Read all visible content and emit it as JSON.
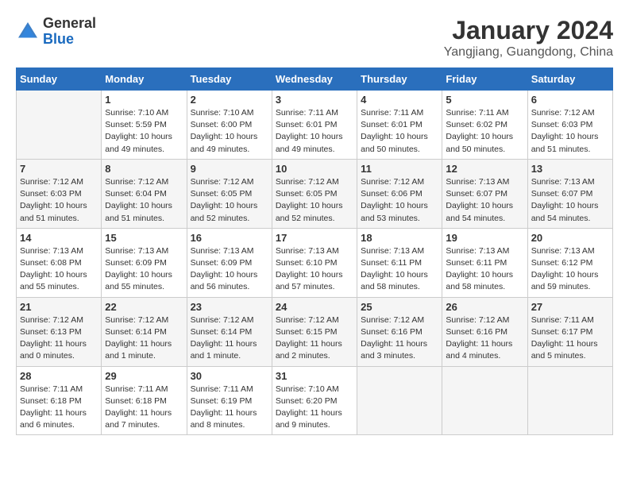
{
  "header": {
    "logo_general": "General",
    "logo_blue": "Blue",
    "month": "January 2024",
    "location": "Yangjiang, Guangdong, China"
  },
  "days_of_week": [
    "Sunday",
    "Monday",
    "Tuesday",
    "Wednesday",
    "Thursday",
    "Friday",
    "Saturday"
  ],
  "weeks": [
    [
      {
        "day": "",
        "sunrise": "",
        "sunset": "",
        "daylight": ""
      },
      {
        "day": "1",
        "sunrise": "Sunrise: 7:10 AM",
        "sunset": "Sunset: 5:59 PM",
        "daylight": "Daylight: 10 hours and 49 minutes."
      },
      {
        "day": "2",
        "sunrise": "Sunrise: 7:10 AM",
        "sunset": "Sunset: 6:00 PM",
        "daylight": "Daylight: 10 hours and 49 minutes."
      },
      {
        "day": "3",
        "sunrise": "Sunrise: 7:11 AM",
        "sunset": "Sunset: 6:01 PM",
        "daylight": "Daylight: 10 hours and 49 minutes."
      },
      {
        "day": "4",
        "sunrise": "Sunrise: 7:11 AM",
        "sunset": "Sunset: 6:01 PM",
        "daylight": "Daylight: 10 hours and 50 minutes."
      },
      {
        "day": "5",
        "sunrise": "Sunrise: 7:11 AM",
        "sunset": "Sunset: 6:02 PM",
        "daylight": "Daylight: 10 hours and 50 minutes."
      },
      {
        "day": "6",
        "sunrise": "Sunrise: 7:12 AM",
        "sunset": "Sunset: 6:03 PM",
        "daylight": "Daylight: 10 hours and 51 minutes."
      }
    ],
    [
      {
        "day": "7",
        "sunrise": "Sunrise: 7:12 AM",
        "sunset": "Sunset: 6:03 PM",
        "daylight": "Daylight: 10 hours and 51 minutes."
      },
      {
        "day": "8",
        "sunrise": "Sunrise: 7:12 AM",
        "sunset": "Sunset: 6:04 PM",
        "daylight": "Daylight: 10 hours and 51 minutes."
      },
      {
        "day": "9",
        "sunrise": "Sunrise: 7:12 AM",
        "sunset": "Sunset: 6:05 PM",
        "daylight": "Daylight: 10 hours and 52 minutes."
      },
      {
        "day": "10",
        "sunrise": "Sunrise: 7:12 AM",
        "sunset": "Sunset: 6:05 PM",
        "daylight": "Daylight: 10 hours and 52 minutes."
      },
      {
        "day": "11",
        "sunrise": "Sunrise: 7:12 AM",
        "sunset": "Sunset: 6:06 PM",
        "daylight": "Daylight: 10 hours and 53 minutes."
      },
      {
        "day": "12",
        "sunrise": "Sunrise: 7:13 AM",
        "sunset": "Sunset: 6:07 PM",
        "daylight": "Daylight: 10 hours and 54 minutes."
      },
      {
        "day": "13",
        "sunrise": "Sunrise: 7:13 AM",
        "sunset": "Sunset: 6:07 PM",
        "daylight": "Daylight: 10 hours and 54 minutes."
      }
    ],
    [
      {
        "day": "14",
        "sunrise": "Sunrise: 7:13 AM",
        "sunset": "Sunset: 6:08 PM",
        "daylight": "Daylight: 10 hours and 55 minutes."
      },
      {
        "day": "15",
        "sunrise": "Sunrise: 7:13 AM",
        "sunset": "Sunset: 6:09 PM",
        "daylight": "Daylight: 10 hours and 55 minutes."
      },
      {
        "day": "16",
        "sunrise": "Sunrise: 7:13 AM",
        "sunset": "Sunset: 6:09 PM",
        "daylight": "Daylight: 10 hours and 56 minutes."
      },
      {
        "day": "17",
        "sunrise": "Sunrise: 7:13 AM",
        "sunset": "Sunset: 6:10 PM",
        "daylight": "Daylight: 10 hours and 57 minutes."
      },
      {
        "day": "18",
        "sunrise": "Sunrise: 7:13 AM",
        "sunset": "Sunset: 6:11 PM",
        "daylight": "Daylight: 10 hours and 58 minutes."
      },
      {
        "day": "19",
        "sunrise": "Sunrise: 7:13 AM",
        "sunset": "Sunset: 6:11 PM",
        "daylight": "Daylight: 10 hours and 58 minutes."
      },
      {
        "day": "20",
        "sunrise": "Sunrise: 7:13 AM",
        "sunset": "Sunset: 6:12 PM",
        "daylight": "Daylight: 10 hours and 59 minutes."
      }
    ],
    [
      {
        "day": "21",
        "sunrise": "Sunrise: 7:12 AM",
        "sunset": "Sunset: 6:13 PM",
        "daylight": "Daylight: 11 hours and 0 minutes."
      },
      {
        "day": "22",
        "sunrise": "Sunrise: 7:12 AM",
        "sunset": "Sunset: 6:14 PM",
        "daylight": "Daylight: 11 hours and 1 minute."
      },
      {
        "day": "23",
        "sunrise": "Sunrise: 7:12 AM",
        "sunset": "Sunset: 6:14 PM",
        "daylight": "Daylight: 11 hours and 1 minute."
      },
      {
        "day": "24",
        "sunrise": "Sunrise: 7:12 AM",
        "sunset": "Sunset: 6:15 PM",
        "daylight": "Daylight: 11 hours and 2 minutes."
      },
      {
        "day": "25",
        "sunrise": "Sunrise: 7:12 AM",
        "sunset": "Sunset: 6:16 PM",
        "daylight": "Daylight: 11 hours and 3 minutes."
      },
      {
        "day": "26",
        "sunrise": "Sunrise: 7:12 AM",
        "sunset": "Sunset: 6:16 PM",
        "daylight": "Daylight: 11 hours and 4 minutes."
      },
      {
        "day": "27",
        "sunrise": "Sunrise: 7:11 AM",
        "sunset": "Sunset: 6:17 PM",
        "daylight": "Daylight: 11 hours and 5 minutes."
      }
    ],
    [
      {
        "day": "28",
        "sunrise": "Sunrise: 7:11 AM",
        "sunset": "Sunset: 6:18 PM",
        "daylight": "Daylight: 11 hours and 6 minutes."
      },
      {
        "day": "29",
        "sunrise": "Sunrise: 7:11 AM",
        "sunset": "Sunset: 6:18 PM",
        "daylight": "Daylight: 11 hours and 7 minutes."
      },
      {
        "day": "30",
        "sunrise": "Sunrise: 7:11 AM",
        "sunset": "Sunset: 6:19 PM",
        "daylight": "Daylight: 11 hours and 8 minutes."
      },
      {
        "day": "31",
        "sunrise": "Sunrise: 7:10 AM",
        "sunset": "Sunset: 6:20 PM",
        "daylight": "Daylight: 11 hours and 9 minutes."
      },
      {
        "day": "",
        "sunrise": "",
        "sunset": "",
        "daylight": ""
      },
      {
        "day": "",
        "sunrise": "",
        "sunset": "",
        "daylight": ""
      },
      {
        "day": "",
        "sunrise": "",
        "sunset": "",
        "daylight": ""
      }
    ]
  ]
}
